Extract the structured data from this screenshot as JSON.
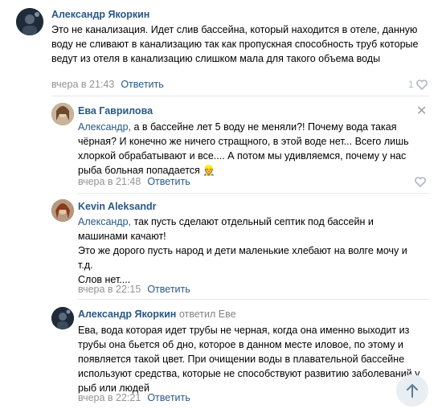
{
  "comments": [
    {
      "author": "Александр Якоркин",
      "text": "Это не канализация. Идет слив бассейна, который находится в отеле, данную воду не сливают в канализацию так как пропускная способность труб которые ведут из отеля в канализацию слишком мала для такого объема воды",
      "time": "вчера в 21:43",
      "reply_label": "Ответить",
      "likes": "1"
    },
    {
      "author": "Ева Гаврилова",
      "mention": "Александр,",
      "text": " а в бассейне лет 5 воду не меняли?! Почему вода такая чёрная? И конечно же ничего стращного, в этой воде нет... Всего лишь хлоркой обрабатывают и все.... А потом мы удивляемся, почему у нас рыба больная попадается",
      "emoji": "👷",
      "time": "вчера в 21:48",
      "reply_label": "Ответить",
      "close": "✕"
    },
    {
      "author": "Kevin Aleksandr",
      "mention": "Александр,",
      "text_line1": " так пусть сделают отдельный септик под бассейн и машинами качают!",
      "text_line2": "Это же дорого пусть народ и дети маленькие хлебают на волге мочу и т.д.",
      "text_line3": "Слов нет....",
      "time": "вчера в 22:15",
      "reply_label": "Ответить"
    },
    {
      "author": "Александр Якоркин",
      "reply_to": "ответил Еве",
      "text": "Ева, вода которая идет трубы не черная, когда она именно выходит из трубы она бьется об дно, которое в данном месте иловое, по этому и появляется такой цвет. При очищении воды в плавательной бассейне используют средства, которые не способствуют развитию заболеваний у рыб или людей",
      "time": "вчера в 22:21",
      "reply_label": "Ответить"
    }
  ],
  "colors": {
    "link": "#2a5885",
    "meta": "#939393",
    "icon": "#b0b8c1"
  },
  "icons": {
    "like": "heart-icon",
    "scroll_top": "arrow-up-icon"
  }
}
